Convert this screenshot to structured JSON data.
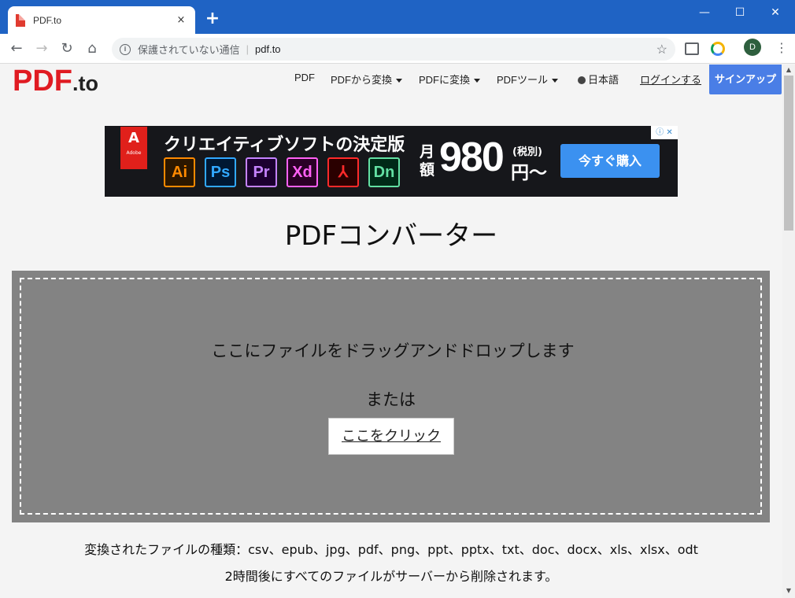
{
  "browser": {
    "tab_title": "PDF.to",
    "tab_close": "×",
    "new_tab": "+",
    "window_controls": {
      "minimize": "—",
      "maximize": "☐",
      "close": "✕"
    },
    "security_text": "保護されていない通信",
    "url": "pdf.to",
    "profile_initial": "D"
  },
  "site": {
    "logo_main": "PDF",
    "logo_suffix": ".to",
    "nav": {
      "pdf": "PDF",
      "from_pdf": "PDFから変換",
      "to_pdf": "PDFに変換",
      "tools": "PDFツール",
      "language": "日本語",
      "login": "ログインする",
      "signup": "サインアップ"
    }
  },
  "ad": {
    "brand_mark": "A",
    "brand_text": "Adobe",
    "headline": "クリエイティブソフトの決定版",
    "apps": [
      {
        "label": "Ai",
        "color": "#ff8a00"
      },
      {
        "label": "Ps",
        "color": "#31a8ff"
      },
      {
        "label": "Pr",
        "color": "#c583ff"
      },
      {
        "label": "Xd",
        "color": "#ff61f6"
      },
      {
        "label": "⅄",
        "color": "#ff2a2a"
      },
      {
        "label": "Dn",
        "color": "#63e0a3"
      }
    ],
    "price_prefix": "月額",
    "price": "980",
    "tax_note": "(税別)",
    "price_suffix": "円〜",
    "cta": "今すぐ購入"
  },
  "main": {
    "title": "PDFコンバーター",
    "drop_text": "ここにファイルをドラッグアンドドロップします",
    "or_text": "または",
    "click_button": "ここをクリック",
    "formats_text": "変換されたファイルの種類：csv、epub、jpg、pdf、png、ppt、pptx、txt、doc、docx、xls、xlsx、odt",
    "deletion_text": "2時間後にすべてのファイルがサーバーから削除されます。"
  }
}
